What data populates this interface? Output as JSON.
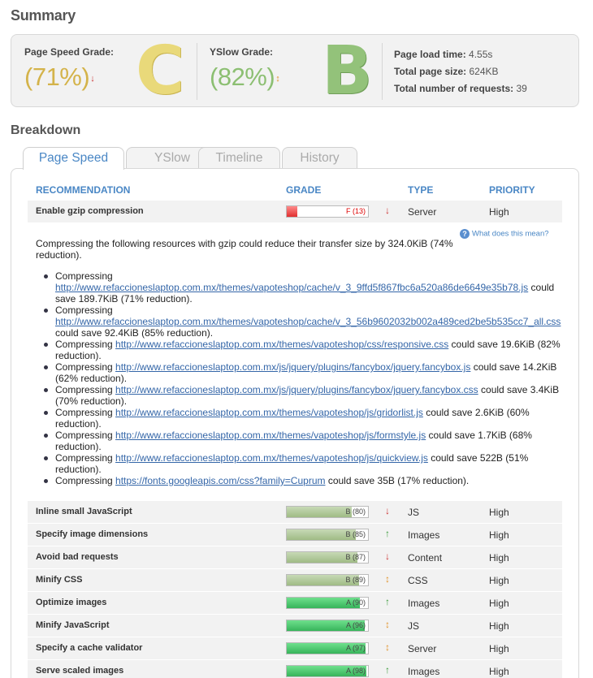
{
  "summary": {
    "heading": "Summary",
    "page_speed": {
      "label": "Page Speed Grade:",
      "value": "(71%)",
      "letter": "C",
      "trend": "↓"
    },
    "yslow": {
      "label": "YSlow Grade:",
      "value": "(82%)",
      "letter": "B",
      "trend": "↕"
    },
    "stats": [
      {
        "label": "Page load time:",
        "value": "4.55s"
      },
      {
        "label": "Total page size:",
        "value": "624KB"
      },
      {
        "label": "Total number of requests:",
        "value": "39"
      }
    ],
    "colors": {
      "grade_c": "#d6b84a",
      "grade_b": "#8cbf72"
    }
  },
  "breakdown": {
    "heading": "Breakdown",
    "tabs": [
      {
        "label": "Page Speed",
        "active": true
      },
      {
        "label": "YSlow",
        "active": false
      },
      {
        "label": "Timeline",
        "active": false
      },
      {
        "label": "History",
        "active": false
      }
    ],
    "columns": {
      "recommendation": "RECOMMENDATION",
      "grade": "GRADE",
      "type": "TYPE",
      "priority": "PRIORITY"
    },
    "first_row": {
      "name": "Enable gzip compression",
      "grade": "F (13)",
      "score": 13,
      "trend": "down",
      "type": "Server",
      "priority": "High"
    },
    "help_link": "What does this mean?",
    "intro": "Compressing the following resources with gzip could reduce their transfer size by 324.0KiB (74% reduction).",
    "resources": [
      {
        "prefix": "Compressing",
        "url": "http://www.refaccioneslaptop.com.mx/themes/vapoteshop/cache/v_3_9ffd5f867fbc6a520a86de6649e35b78.js",
        "suffix": "could save 189.7KiB (71% reduction)."
      },
      {
        "prefix": "Compressing",
        "url": "http://www.refaccioneslaptop.com.mx/themes/vapoteshop/cache/v_3_56b9602032b002a489ced2be5b535cc7_all.css",
        "suffix": "could save 92.4KiB (85% reduction)."
      },
      {
        "prefix": "Compressing",
        "url": "http://www.refaccioneslaptop.com.mx/themes/vapoteshop/css/responsive.css",
        "suffix": "could save 19.6KiB (82% reduction)."
      },
      {
        "prefix": "Compressing",
        "url": "http://www.refaccioneslaptop.com.mx/js/jquery/plugins/fancybox/jquery.fancybox.js",
        "suffix": "could save 14.2KiB (62% reduction)."
      },
      {
        "prefix": "Compressing",
        "url": "http://www.refaccioneslaptop.com.mx/js/jquery/plugins/fancybox/jquery.fancybox.css",
        "suffix": "could save 3.4KiB (70% reduction)."
      },
      {
        "prefix": "Compressing",
        "url": "http://www.refaccioneslaptop.com.mx/themes/vapoteshop/js/gridorlist.js",
        "suffix": "could save 2.6KiB (60% reduction)."
      },
      {
        "prefix": "Compressing",
        "url": "http://www.refaccioneslaptop.com.mx/themes/vapoteshop/js/formstyle.js",
        "suffix": "could save 1.7KiB (68% reduction)."
      },
      {
        "prefix": "Compressing",
        "url": "http://www.refaccioneslaptop.com.mx/themes/vapoteshop/js/quickview.js",
        "suffix": "could save 522B (51% reduction)."
      },
      {
        "prefix": "Compressing",
        "url": "https://fonts.googleapis.com/css?family=Cuprum",
        "suffix": "could save 35B (17% reduction)."
      }
    ],
    "rows": [
      {
        "name": "Inline small JavaScript",
        "grade": "B (80)",
        "score": 80,
        "trend": "down",
        "type": "JS",
        "priority": "High"
      },
      {
        "name": "Specify image dimensions",
        "grade": "B (85)",
        "score": 85,
        "trend": "up",
        "type": "Images",
        "priority": "High"
      },
      {
        "name": "Avoid bad requests",
        "grade": "B (87)",
        "score": 87,
        "trend": "down",
        "type": "Content",
        "priority": "High"
      },
      {
        "name": "Minify CSS",
        "grade": "B (89)",
        "score": 89,
        "trend": "both",
        "type": "CSS",
        "priority": "High"
      },
      {
        "name": "Optimize images",
        "grade": "A (90)",
        "score": 90,
        "trend": "up",
        "type": "Images",
        "priority": "High"
      },
      {
        "name": "Minify JavaScript",
        "grade": "A (96)",
        "score": 96,
        "trend": "both",
        "type": "JS",
        "priority": "High"
      },
      {
        "name": "Specify a cache validator",
        "grade": "A (97)",
        "score": 97,
        "trend": "both",
        "type": "Server",
        "priority": "High"
      },
      {
        "name": "Serve scaled images",
        "grade": "A (98)",
        "score": 98,
        "trend": "up",
        "type": "Images",
        "priority": "High"
      }
    ]
  }
}
